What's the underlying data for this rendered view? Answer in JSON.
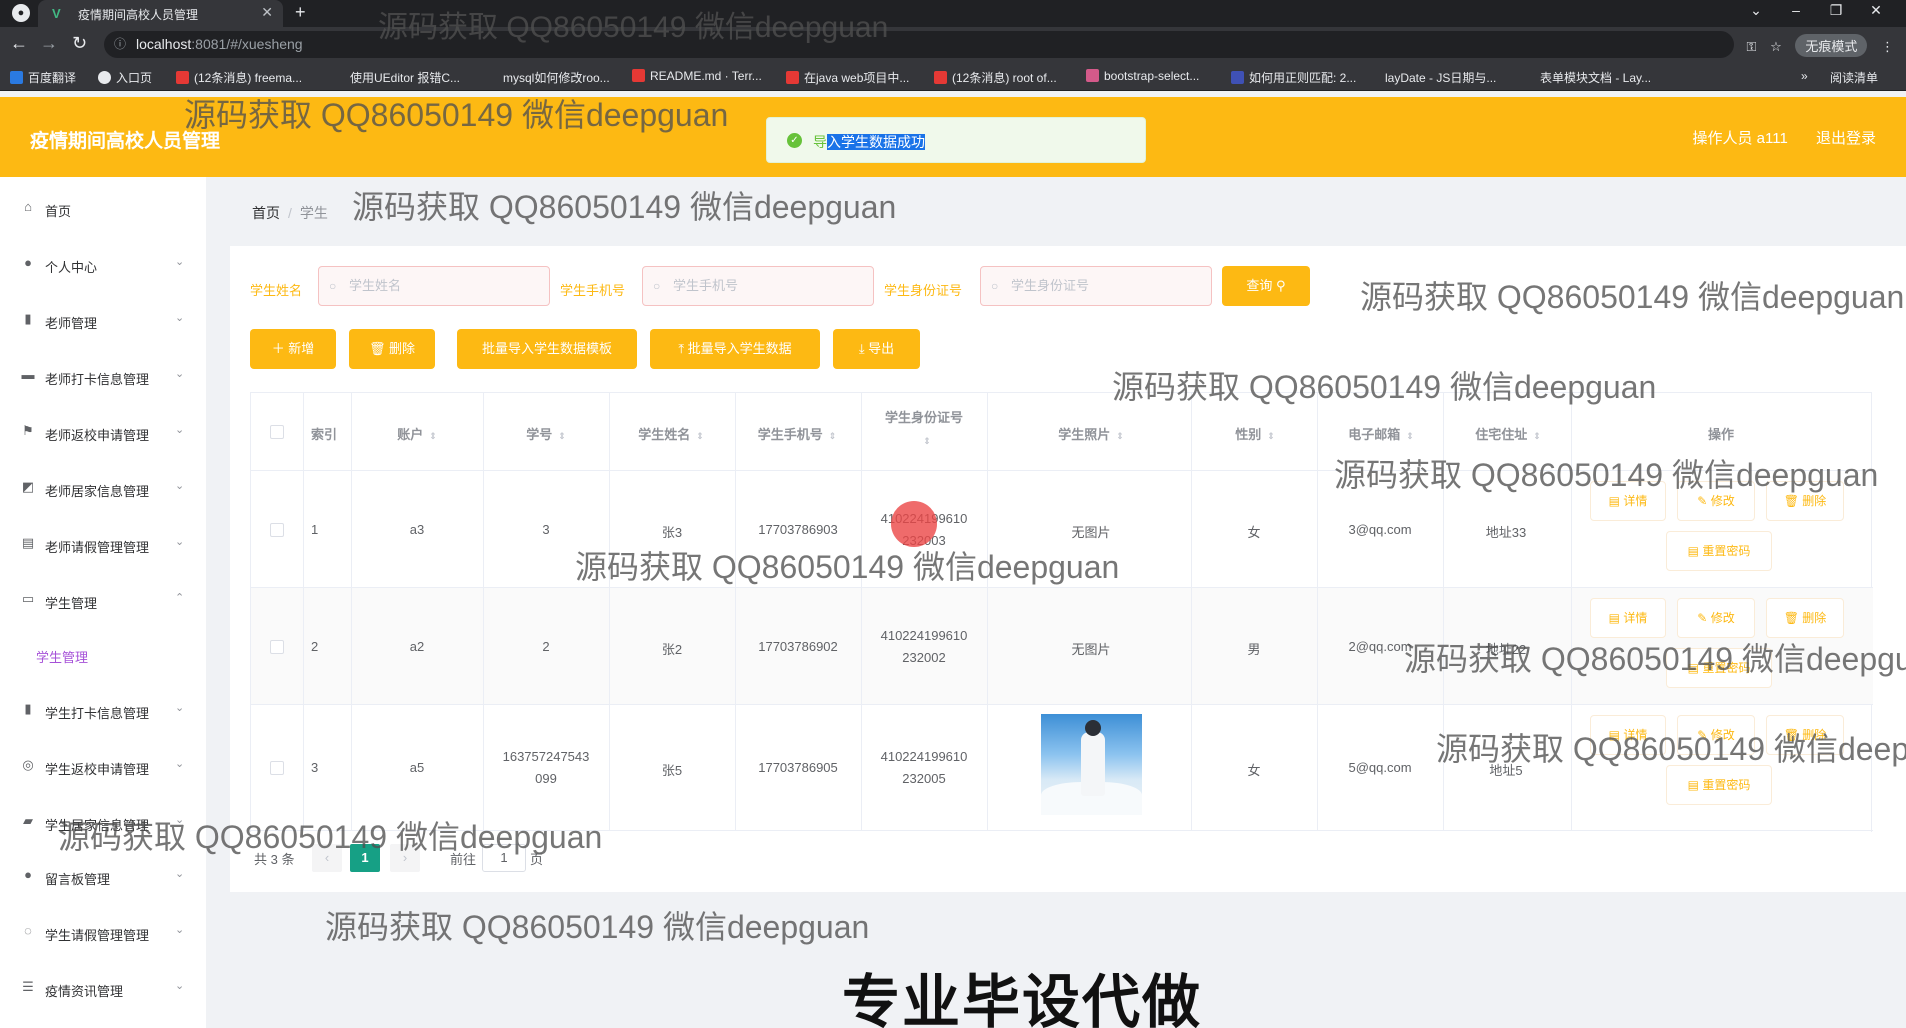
{
  "browser": {
    "tab_title": "疫情期间高校人员管理",
    "tab_close": "✕",
    "new_tab": "+",
    "url_host": "localhost",
    "url_path": ":8081/#/xuesheng",
    "incognito": "无痕模式",
    "bookmarks": [
      "百度翻译",
      "入口页",
      "(12条消息) freema...",
      "使用UEditor 报错C...",
      "mysql如何修改roo...",
      "README.md · Terr...",
      "在java web项目中...",
      "(12条消息) root of...",
      "bootstrap-select...",
      "如何用正则匹配: 2...",
      "layDate - JS日期与...",
      "表单模块文档 - Lay..."
    ],
    "reading_list": "阅读清单",
    "bookmark_more": "»"
  },
  "header": {
    "title": "疫情期间高校人员管理",
    "operator": "操作人员 a111",
    "logout": "退出登录"
  },
  "toast": {
    "prefix": "导",
    "selected": "入学生数据成功"
  },
  "sidebar": {
    "items": [
      {
        "label": "首页",
        "icon": "home-icon",
        "glyph": "⌂",
        "arrow": ""
      },
      {
        "label": "个人中心",
        "icon": "user-icon",
        "glyph": "●",
        "arrow": "⌄"
      },
      {
        "label": "老师管理",
        "icon": "bar-chart-icon",
        "glyph": "▮",
        "arrow": "⌄"
      },
      {
        "label": "老师打卡信息管理",
        "icon": "printer-icon",
        "glyph": "▬",
        "arrow": "⌄"
      },
      {
        "label": "老师返校申请管理",
        "icon": "flag-icon",
        "glyph": "⚑",
        "arrow": "⌄"
      },
      {
        "label": "老师居家信息管理",
        "icon": "chart-icon",
        "glyph": "◩",
        "arrow": "⌄"
      },
      {
        "label": "老师请假管理管理",
        "icon": "clipboard-icon",
        "glyph": "▤",
        "arrow": "⌄"
      },
      {
        "label": "学生管理",
        "icon": "monitor-icon",
        "glyph": "▭",
        "arrow": "⌃"
      },
      {
        "label": "学生管理",
        "icon": "",
        "glyph": "",
        "arrow": ""
      },
      {
        "label": "学生打卡信息管理",
        "icon": "bar-chart-icon",
        "glyph": "▮",
        "arrow": "⌄"
      },
      {
        "label": "学生返校申请管理",
        "icon": "target-icon",
        "glyph": "◎",
        "arrow": "⌄"
      },
      {
        "label": "学生居家信息管理",
        "icon": "folder-icon",
        "glyph": "▰",
        "arrow": "⌄"
      },
      {
        "label": "留言板管理",
        "icon": "user-icon",
        "glyph": "●",
        "arrow": "⌄"
      },
      {
        "label": "学生请假管理管理",
        "icon": "compass-icon",
        "glyph": "◌",
        "arrow": "⌄"
      },
      {
        "label": "疫情资讯管理",
        "icon": "list-icon",
        "glyph": "☰",
        "arrow": "⌄"
      }
    ]
  },
  "breadcrumb": {
    "home": "首页",
    "sep": "/",
    "current": "学生"
  },
  "search": {
    "name_label": "学生姓名",
    "name_placeholder": "学生姓名",
    "phone_label": "学生手机号",
    "phone_placeholder": "学生手机号",
    "id_label": "学生身份证号",
    "id_placeholder": "学生身份证号",
    "query": "查询"
  },
  "actions": {
    "add": "＋ 新增",
    "delete": "🗑 删除",
    "template": "批量导入学生数据模板",
    "import": "⤒ 批量导入学生数据",
    "export": "⤓ 导出"
  },
  "table": {
    "headers": {
      "index": "索引",
      "account": "账户",
      "student_no": "学号",
      "name": "学生姓名",
      "phone": "学生手机号",
      "id_card": "学生身份证号",
      "photo": "学生照片",
      "gender": "性别",
      "email": "电子邮箱",
      "address": "住宅住址",
      "ops": "操作"
    },
    "sort_glyph": "⇕",
    "rows": [
      {
        "index": "1",
        "account": "a3",
        "student_no": "3",
        "name": "张3",
        "phone": "17703786903",
        "id1": "410224199610",
        "id2": "232003",
        "photo": "无图片",
        "gender": "女",
        "email": "3@qq.com",
        "address": "地址33"
      },
      {
        "index": "2",
        "account": "a2",
        "student_no": "2",
        "name": "张2",
        "phone": "17703786902",
        "id1": "410224199610",
        "id2": "232002",
        "photo": "无图片",
        "gender": "男",
        "email": "2@qq.com",
        "address": "地址22"
      },
      {
        "index": "3",
        "account": "a5",
        "student_no": "163757247543",
        "student_no2": "099",
        "name": "张5",
        "phone": "17703786905",
        "id1": "410224199610",
        "id2": "232005",
        "photo": "",
        "gender": "女",
        "email": "5@qq.com",
        "address": "地址5"
      }
    ],
    "ops": {
      "detail": "详情",
      "edit": "修改",
      "delete": "删除",
      "reset": "重置密码"
    }
  },
  "pagination": {
    "total": "共 3 条",
    "page": "1",
    "goto": "前往",
    "goto_value": "1",
    "page_unit": "页",
    "prev": "‹",
    "next": "›"
  },
  "watermark": "源码获取 QQ86050149 微信deepguan",
  "banner": "专业毕设代做",
  "colors": {
    "accent": "#fdb913",
    "success": "#67c23a",
    "active_page": "#16a085",
    "submenu": "#a651d8"
  }
}
